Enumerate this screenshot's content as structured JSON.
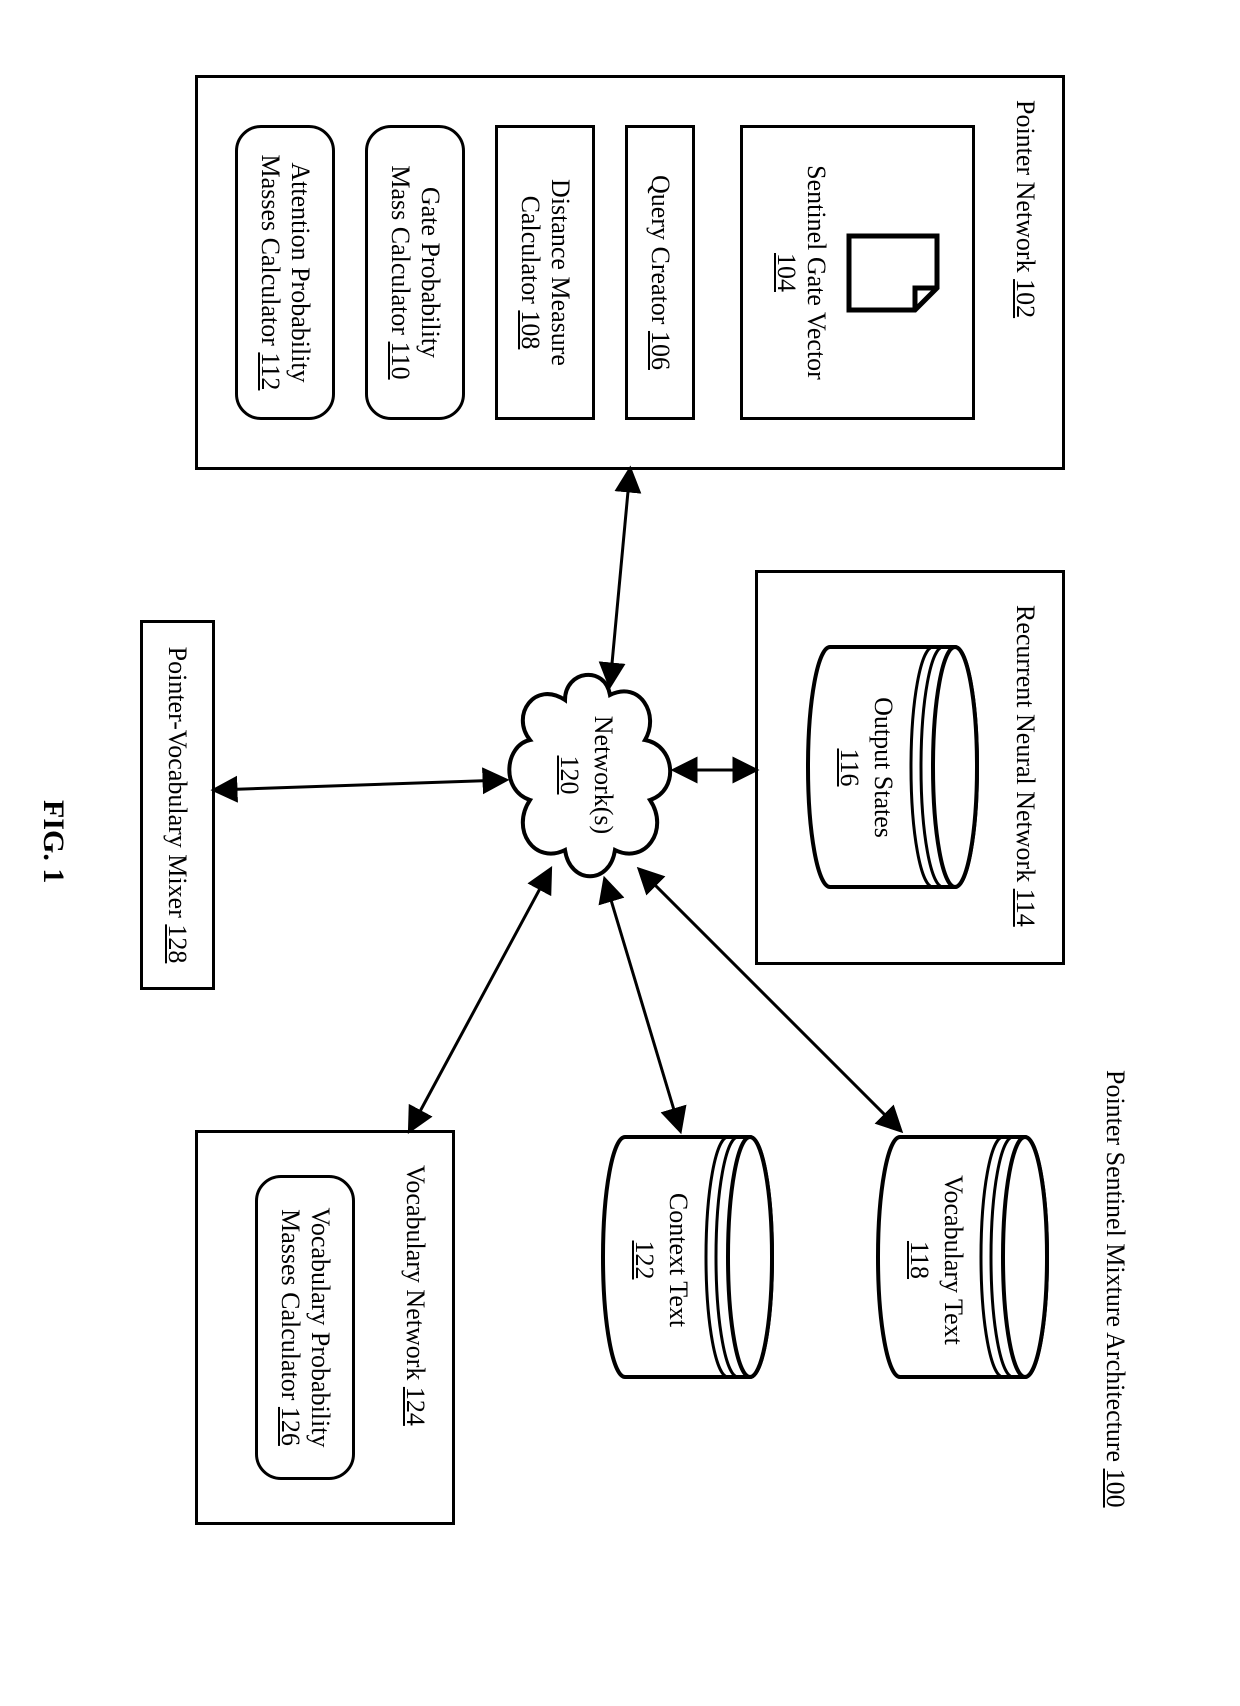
{
  "title": "Pointer Sentinel Mixture Architecture",
  "title_num": "100",
  "fig": "FIG. 1",
  "pn": {
    "title": "Pointer Network",
    "num": "102"
  },
  "sgv": {
    "label": "Sentinel Gate Vector",
    "num": "104"
  },
  "qc": {
    "label": "Query Creator",
    "num": "106"
  },
  "dmc": {
    "line1": "Distance Measure",
    "line2": "Calculator",
    "num": "108"
  },
  "gpmc": {
    "line1": "Gate Probability",
    "line2": "Mass Calculator",
    "num": "110"
  },
  "apmc": {
    "line1": "Attention Probability",
    "line2": "Masses Calculator",
    "num": "112"
  },
  "rnn": {
    "title": "Recurrent Neural Network",
    "num": "114"
  },
  "out": {
    "label": "Output States",
    "num": "116"
  },
  "vt": {
    "label": "Vocabulary Text",
    "num": "118"
  },
  "ct": {
    "label": "Context Text",
    "num": "122"
  },
  "net": {
    "label": "Network(s)",
    "num": "120"
  },
  "vn": {
    "title": "Vocabulary Network",
    "num": "124"
  },
  "vpmc": {
    "line1": "Vocabulary Probability",
    "line2": "Masses Calculator",
    "num": "126"
  },
  "pvm": {
    "label": "Pointer-Vocabulary Mixer",
    "num": "128"
  }
}
